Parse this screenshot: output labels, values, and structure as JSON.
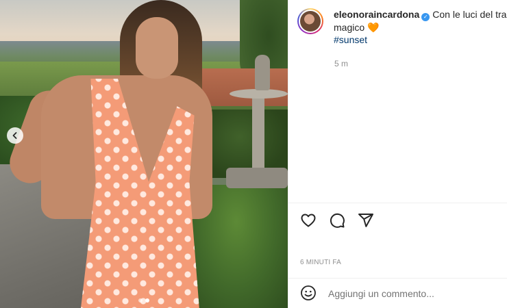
{
  "post": {
    "username": "eleonoraincardona",
    "caption": "Con le luci del tramonto tutto è magico",
    "caption_line1": "Con le luci del tram",
    "caption_line2": "magico",
    "heart_emoji": "🧡",
    "hashtag": "#sunset",
    "time_ago": "5 m",
    "date_label": "6 MINUTI FA",
    "carousel": {
      "slides": 2,
      "active_index": 1
    }
  },
  "comment": {
    "placeholder": "Aggiungi un commento..."
  },
  "colors": {
    "verified": "#3897f0",
    "heart": "#f07a1e",
    "hashtag": "#00376b"
  },
  "icons": [
    "chevron-left-icon",
    "verified-badge-icon",
    "heart-icon",
    "comment-icon",
    "share-icon",
    "emoji-icon"
  ]
}
